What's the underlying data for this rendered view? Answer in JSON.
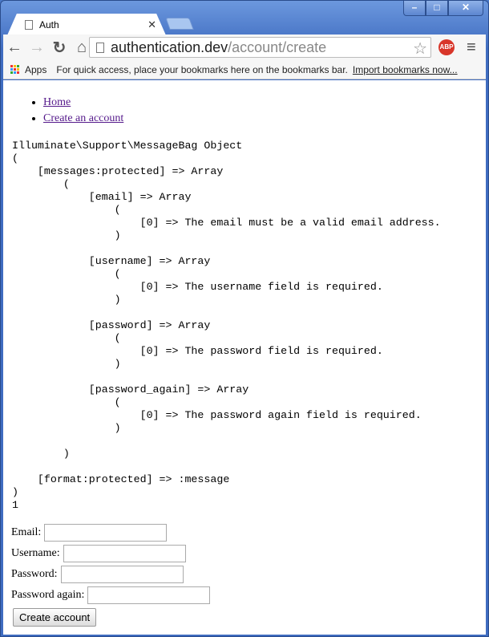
{
  "browser": {
    "tab_title": "Auth",
    "url_host": "authentication.dev",
    "url_path": "/account/create",
    "abp_label": "ABP",
    "bookmarks": {
      "apps": "Apps",
      "hint": "For quick access, place your bookmarks here on the bookmarks bar.",
      "import": "Import bookmarks now..."
    }
  },
  "nav": [
    {
      "label": "Home"
    },
    {
      "label": "Create an account"
    }
  ],
  "debug_output": "Illuminate\\Support\\MessageBag Object\n(\n    [messages:protected] => Array\n        (\n            [email] => Array\n                (\n                    [0] => The email must be a valid email address.\n                )\n\n            [username] => Array\n                (\n                    [0] => The username field is required.\n                )\n\n            [password] => Array\n                (\n                    [0] => The password field is required.\n                )\n\n            [password_again] => Array\n                (\n                    [0] => The password again field is required.\n                )\n\n        )\n\n    [format:protected] => :message\n)\n1",
  "form": {
    "email_label": "Email:",
    "email_value": "",
    "username_label": "Username:",
    "username_value": "",
    "password_label": "Password:",
    "password_value": "",
    "password_again_label": "Password again:",
    "password_again_value": "",
    "submit": "Create account"
  }
}
